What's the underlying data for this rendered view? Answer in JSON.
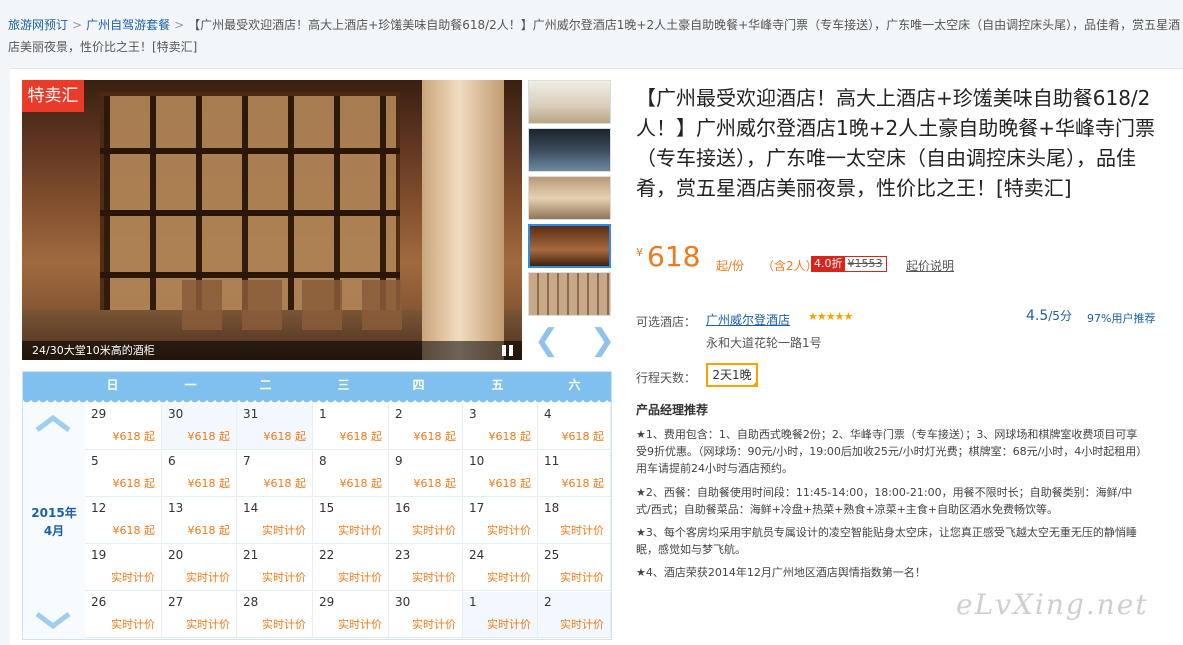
{
  "breadcrumb": {
    "home": "旅游网预订",
    "category": "广州自驾游套餐",
    "current": "【广州最受欢迎酒店！高大上酒店+珍馐美味自助餐618/2人！】广州威尔登酒店1晚+2人土豪自助晚餐+华峰寺门票（专车接送），广东唯一太空床（自由调控床头尾），品佳肴，赏五星酒店美丽夜景，性价比之王！[特卖汇]"
  },
  "gallery": {
    "badge": "特卖汇",
    "caption": "24/30大堂10米高的酒柜",
    "prev_icon": "❮",
    "next_icon": "❯"
  },
  "calendar": {
    "weekdays": [
      "日",
      "一",
      "二",
      "三",
      "四",
      "五",
      "六"
    ],
    "year": "2015年",
    "month": "4月",
    "weeks": [
      [
        {
          "d": "29",
          "p": "¥618 起"
        },
        {
          "d": "30",
          "p": "¥618 起"
        },
        {
          "d": "31",
          "p": "¥618 起"
        },
        {
          "d": "1",
          "p": "¥618 起"
        },
        {
          "d": "2",
          "p": "¥618 起"
        },
        {
          "d": "3",
          "p": "¥618 起"
        },
        {
          "d": "4",
          "p": "¥618 起"
        }
      ],
      [
        {
          "d": "5",
          "p": "¥618 起"
        },
        {
          "d": "6",
          "p": "¥618 起"
        },
        {
          "d": "7",
          "p": "¥618 起"
        },
        {
          "d": "8",
          "p": "¥618 起"
        },
        {
          "d": "9",
          "p": "¥618 起"
        },
        {
          "d": "10",
          "p": "¥618 起"
        },
        {
          "d": "11",
          "p": "¥618 起"
        }
      ],
      [
        {
          "d": "12",
          "p": "¥618 起"
        },
        {
          "d": "13",
          "p": "¥618 起"
        },
        {
          "d": "14",
          "p": "实时计价"
        },
        {
          "d": "15",
          "p": "实时计价"
        },
        {
          "d": "16",
          "p": "实时计价"
        },
        {
          "d": "17",
          "p": "实时计价"
        },
        {
          "d": "18",
          "p": "实时计价"
        }
      ],
      [
        {
          "d": "19",
          "p": "实时计价"
        },
        {
          "d": "20",
          "p": "实时计价"
        },
        {
          "d": "21",
          "p": "实时计价"
        },
        {
          "d": "22",
          "p": "实时计价"
        },
        {
          "d": "23",
          "p": "实时计价"
        },
        {
          "d": "24",
          "p": "实时计价"
        },
        {
          "d": "25",
          "p": "实时计价"
        }
      ],
      [
        {
          "d": "26",
          "p": "实时计价"
        },
        {
          "d": "27",
          "p": "实时计价"
        },
        {
          "d": "28",
          "p": "实时计价"
        },
        {
          "d": "29",
          "p": "实时计价"
        },
        {
          "d": "30",
          "p": "实时计价"
        },
        {
          "d": "1",
          "p": "实时计价"
        },
        {
          "d": "2",
          "p": "实时计价"
        }
      ]
    ]
  },
  "product": {
    "title": "【广州最受欢迎酒店！高大上酒店+珍馐美味自助餐618/2人！】广州威尔登酒店1晚+2人土豪自助晚餐+华峰寺门票（专车接送），广东唯一太空床（自由调控床头尾），品佳肴，赏五星酒店美丽夜景，性价比之王！[特卖汇]",
    "currency": "¥",
    "price": "618",
    "unit": "起/份",
    "people": "（含2人）",
    "discount": "4.0折",
    "original_price": "¥1553",
    "price_note": "起价说明"
  },
  "hotel": {
    "label": "可选酒店：",
    "name": "广州威尔登酒店",
    "stars": "★★★★★",
    "score": "4.5",
    "score_max": "/5分",
    "recommend": "97%用户推荐",
    "address": "永和大道花轮一路1号"
  },
  "trip": {
    "label": "行程天数：",
    "value": "2天1晚"
  },
  "manager": {
    "heading": "产品经理推荐",
    "items": [
      "★1、费用包含：1、自助西式晚餐2份；2、华峰寺门票（专车接送）；3、网球场和棋牌室收费项目可享受9折优惠。（网球场：90元/小时，19:00后加收25元/小时灯光费；棋牌室：68元/小时，4小时起租用）用车请提前24小时与酒店预约。",
      "★2、西餐：自助餐使用时间段：11:45-14:00，18:00-21:00，用餐不限时长；自助餐类别：海鲜/中式/西式；自助餐菜品：海鲜+冷盘+热菜+熟食+凉菜+主食+自助区酒水免费畅饮等。",
      "★3、每个客房均采用宇航员专属设计的凌空智能贴身太空床，让您真正感受飞越太空无重无压的静悄睡眠，感觉如与梦飞航。",
      "★4、酒店荣获2014年12月广州地区酒店舆情指数第一名！"
    ]
  },
  "watermark": "eLvXing.net"
}
